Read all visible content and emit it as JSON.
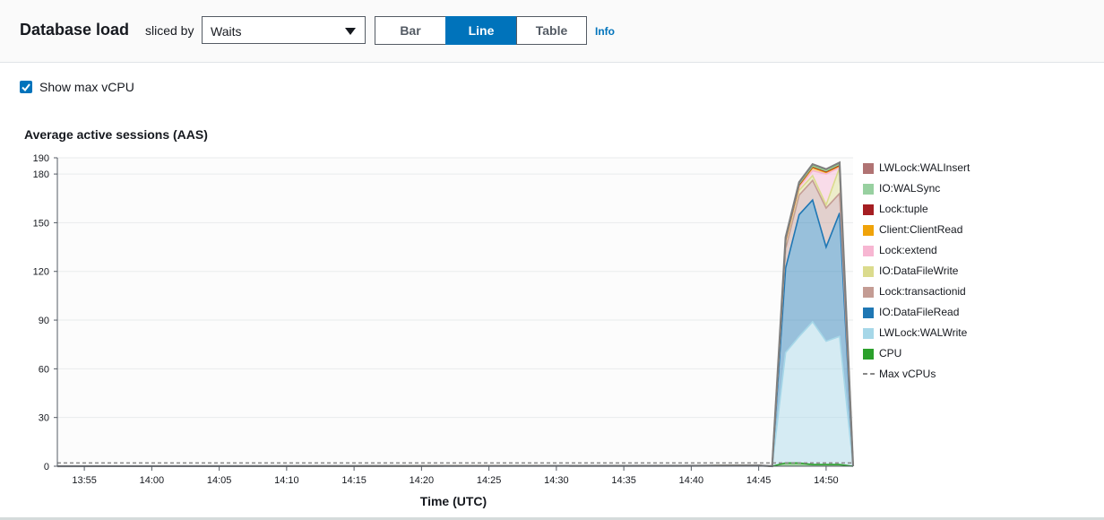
{
  "header": {
    "title": "Database load",
    "sliced_by_label": "sliced by",
    "slice_select": {
      "value": "Waits"
    },
    "view_tabs": [
      {
        "label": "Bar",
        "active": false
      },
      {
        "label": "Line",
        "active": true
      },
      {
        "label": "Table",
        "active": false
      }
    ],
    "info_link": "Info"
  },
  "options": {
    "show_max_vcpu": {
      "label": "Show max vCPU",
      "checked": true
    }
  },
  "chart_data": {
    "type": "area",
    "title": "Average active sessions (AAS)",
    "xlabel": "Time (UTC)",
    "ylabel": "",
    "x_ticks": [
      "13:55",
      "14:00",
      "14:05",
      "14:10",
      "14:15",
      "14:20",
      "14:25",
      "14:30",
      "14:35",
      "14:40",
      "14:45",
      "14:50"
    ],
    "y_ticks": [
      0,
      30,
      60,
      90,
      120,
      150,
      180,
      190
    ],
    "ylim": [
      0,
      190
    ],
    "grid": true,
    "legend_position": "right",
    "x": [
      "13:53",
      "14:39",
      "14:45",
      "14:46",
      "14:47",
      "14:48",
      "14:49",
      "14:50",
      "14:51",
      "14:52"
    ],
    "series": [
      {
        "name": "CPU",
        "color": "#2ca02c",
        "values": [
          0,
          0.3,
          0.5,
          0,
          2,
          2,
          1,
          1,
          1,
          0
        ]
      },
      {
        "name": "LWLock:WALWrite",
        "color": "#a6d7e8",
        "values": [
          0,
          0,
          0,
          0,
          68,
          78,
          88,
          76,
          79,
          0
        ]
      },
      {
        "name": "IO:DataFileRead",
        "color": "#1f77b4",
        "values": [
          0,
          0,
          0,
          0,
          52,
          75,
          75,
          58,
          76,
          0
        ]
      },
      {
        "name": "Lock:transactionid",
        "color": "#c49c94",
        "values": [
          0,
          0,
          0,
          0,
          12,
          12,
          12,
          24,
          12,
          0
        ]
      },
      {
        "name": "IO:DataFileWrite",
        "color": "#dbdb8d",
        "values": [
          0,
          0,
          0,
          0,
          3,
          3,
          3,
          2,
          16,
          0
        ]
      },
      {
        "name": "Lock:extend",
        "color": "#f7b6d2",
        "values": [
          0,
          0,
          0,
          0,
          1,
          2,
          3,
          19,
          0,
          0
        ]
      },
      {
        "name": "Client:ClientRead",
        "color": "#f0a30a",
        "values": [
          0,
          0,
          0,
          0,
          1,
          1,
          2,
          1,
          1,
          0
        ]
      },
      {
        "name": "Lock:tuple",
        "color": "#a51e22",
        "values": [
          0,
          0,
          0,
          0,
          0.5,
          0.5,
          0.5,
          0.5,
          0.5,
          0
        ]
      },
      {
        "name": "IO:WALSync",
        "color": "#98df8a",
        "values": [
          0,
          0,
          0,
          0,
          0.5,
          0.5,
          0.5,
          0.5,
          0.5,
          0
        ]
      },
      {
        "name": "LWLock:WALInsert",
        "color": "#b07373",
        "values": [
          0,
          0,
          0,
          0,
          1,
          1,
          1,
          1,
          1,
          0
        ]
      }
    ],
    "max_vcpu": {
      "name": "Max vCPUs",
      "value": 2,
      "color": "#878787"
    }
  },
  "legend": [
    {
      "name": "LWLock:WALInsert",
      "color": "#b07373",
      "style": "swatch"
    },
    {
      "name": "IO:WALSync",
      "color": "#98d0a0",
      "style": "swatch"
    },
    {
      "name": "Lock:tuple",
      "color": "#a51e22",
      "style": "swatch"
    },
    {
      "name": "Client:ClientRead",
      "color": "#f0a30a",
      "style": "swatch"
    },
    {
      "name": "Lock:extend",
      "color": "#f7b6d2",
      "style": "swatch"
    },
    {
      "name": "IO:DataFileWrite",
      "color": "#dbdb8d",
      "style": "swatch"
    },
    {
      "name": "Lock:transactionid",
      "color": "#c49c94",
      "style": "swatch"
    },
    {
      "name": "IO:DataFileRead",
      "color": "#1f77b4",
      "style": "swatch"
    },
    {
      "name": "LWLock:WALWrite",
      "color": "#a6d7e8",
      "style": "swatch"
    },
    {
      "name": "CPU",
      "color": "#2ca02c",
      "style": "swatch"
    },
    {
      "name": "Max vCPUs",
      "color": "#878787",
      "style": "dashed"
    }
  ]
}
